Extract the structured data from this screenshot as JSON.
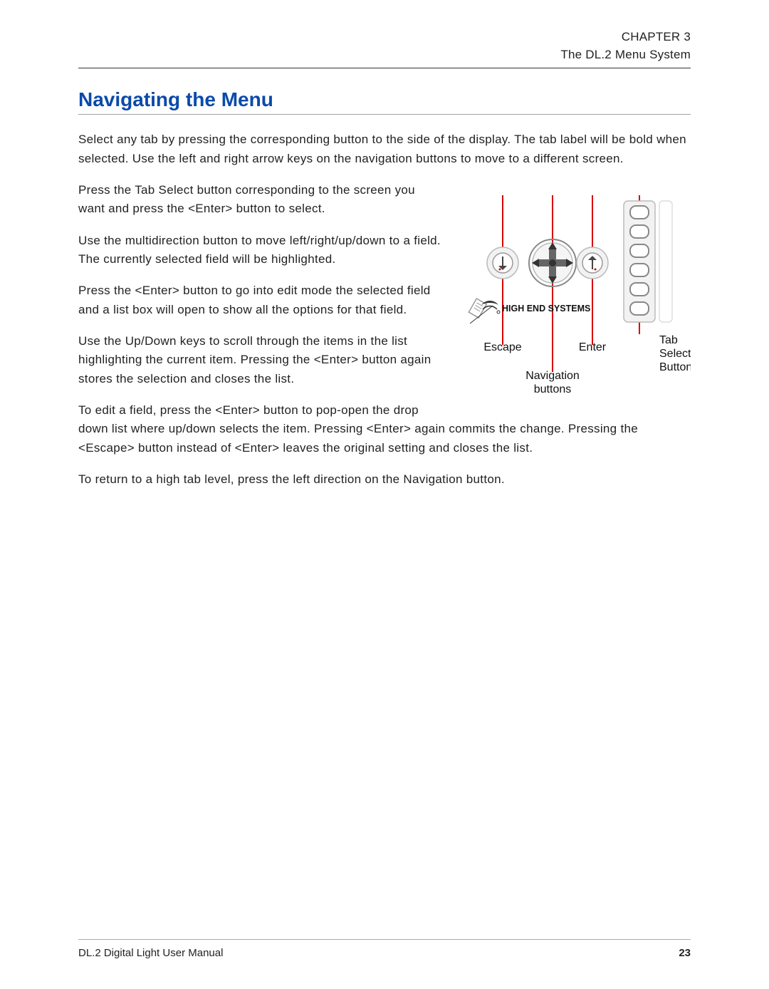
{
  "header": {
    "chapter": "CHAPTER 3",
    "subtitle": "The DL.2 Menu System"
  },
  "section_title": "Navigating the Menu",
  "paragraphs": {
    "p1": "Select any tab by pressing the corresponding button to the side of the display. The tab label will be bold when selected. Use the left and right arrow keys on the navigation buttons to move to a different screen.",
    "p2": "Press the Tab Select button corresponding to the screen you want and press the <Enter> button to select.",
    "p3": "Use the multidirection button to move left/right/up/down to a field. The currently selected field will be highlighted.",
    "p4": "Press the <Enter> button to go into edit mode the selected field and a list box will open to show all the options for that field.",
    "p5": "Use the Up/Down keys to scroll through the items in the list highlighting the current item. Pressing the <Enter> button again stores the selection and closes the list.",
    "p6": "To edit a field, press the <Enter> button to pop-open the drop down list where up/down selects the item. Pressing <Enter> again commits the change. Pressing the <Escape> button instead of <Enter> leaves the original setting and closes the list.",
    "p7": "To return to a high tab level, press the left direction on the Navigation button."
  },
  "figure": {
    "brand": "HIGH END SYSTEMS",
    "label_escape": "Escape",
    "label_enter": "Enter",
    "label_nav": "Navigation buttons",
    "label_tab": "Tab Select Buttons"
  },
  "footer": {
    "left": "DL.2 Digital Light User Manual",
    "page": "23"
  }
}
